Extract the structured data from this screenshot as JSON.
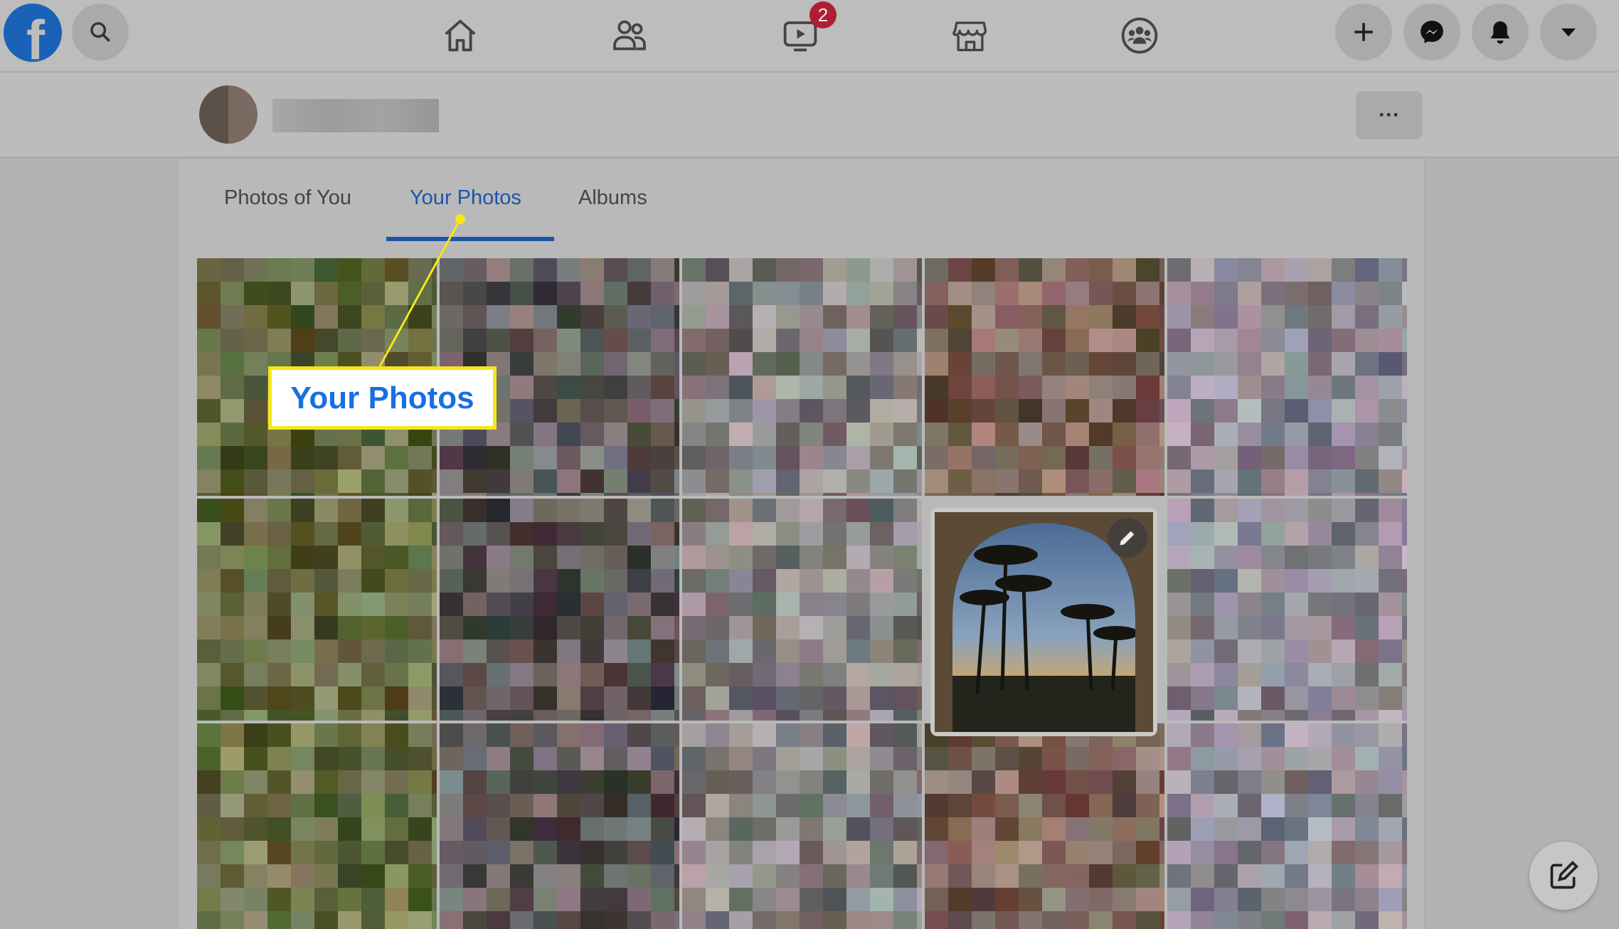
{
  "topbar": {
    "logo_letter": "f",
    "icons": [
      "search-icon",
      "home-icon",
      "friends-icon",
      "watch-icon",
      "marketplace-icon",
      "groups-icon",
      "plus-icon",
      "messenger-icon",
      "notifications-icon",
      "dropdown-icon"
    ],
    "watch_badge": "2"
  },
  "profile": {
    "more_label": "···"
  },
  "tabs": [
    {
      "label": "Photos of You",
      "active": false
    },
    {
      "label": "Your Photos",
      "active": true
    },
    {
      "label": "Albums",
      "active": false
    }
  ],
  "callout": {
    "label": "Your Photos"
  },
  "colors": {
    "accent": "#1d54a8",
    "callout_border": "#f6e61a",
    "badge": "#b01e35"
  }
}
